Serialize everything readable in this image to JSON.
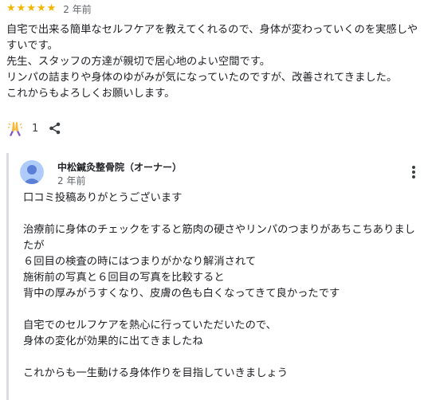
{
  "review": {
    "rating": 5,
    "star_icon": "star-icon",
    "time": "2 年前",
    "text": "自宅で出来る簡単なセルフケアを教えてくれるので、身体が変わっていくのを実感しやすいです。\n先生、スタッフの方達が親切で居心地のよい空間です。\nリンパの詰まりや身体のゆがみが気になっていたのですが、改善されてきました。\nこれからもよろしくお願いします。",
    "like_count": "1",
    "like_icon": "clapping-hands-icon",
    "share_icon": "share-icon"
  },
  "reply": {
    "owner_name": "中松鍼灸整骨院（オーナー）",
    "time": "2 年前",
    "more_icon": "more-vert-icon",
    "text": "口コミ投稿ありがとうございます\n\n治療前に身体のチェックをすると筋肉の硬さやリンパのつまりがあちこちありましたが\n６回目の検査の時にはつまりがかなり解消されて\n施術前の写真と６回目の写真を比較すると\n背中の厚みがうすくなり、皮膚の色も白くなってきて良かったです\n\n自宅でのセルフケアを熱心に行っていただいたので、\n身体の変化が効果的に出てきましたね\n\nこれからも一生動ける身体作りを目指していきましょう"
  },
  "colors": {
    "star": "#f4b400",
    "clap": "#f6b93b",
    "clap_sleeve": "#7e57c2",
    "avatar_bg": "#aecbfa",
    "avatar_fg": "#5b7fd6",
    "reply_border": "#dadce0"
  }
}
